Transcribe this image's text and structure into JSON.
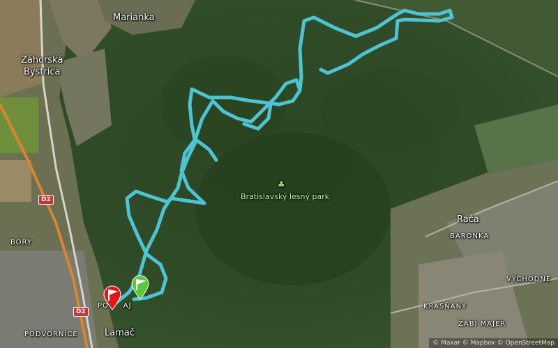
{
  "map": {
    "places": {
      "marianka": "Marianka",
      "zahorska_bystrica": "Záhorská\nBystrica",
      "park": "Bratislavský lesný park",
      "raca": "Rača",
      "baronka": "BARONKA",
      "vychodne": "VÝCHODNÉ",
      "krasnany": "KRASŇANY",
      "zabi_majer": "ŽABÍ MAJER",
      "bory": "BORY",
      "podvornice": "PODVORNICE",
      "lamac": "Lamač",
      "polianky": "PO     AJ"
    },
    "road_shields": [
      "D2",
      "D2"
    ],
    "attribution": "© Maxar © Mapbox © OpenStreetMap",
    "route_color": "#4fc3d3",
    "start_marker_color": "#5cc63e",
    "finish_marker_color": "#e3161c"
  }
}
